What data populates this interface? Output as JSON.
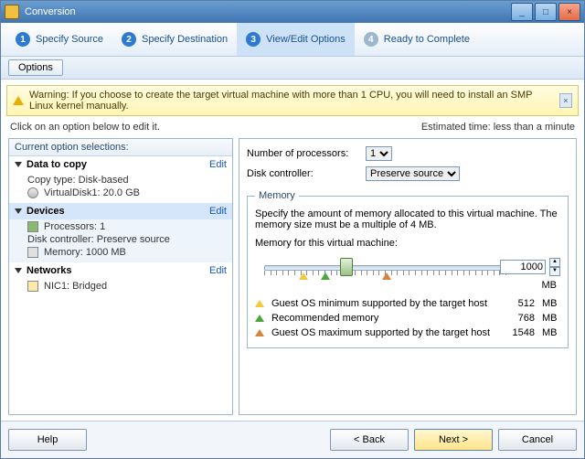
{
  "window": {
    "title": "Conversion"
  },
  "winbtn": {
    "min": "_",
    "max": "□",
    "close": "×"
  },
  "wizard": {
    "steps": [
      {
        "num": "1",
        "label": "Specify Source"
      },
      {
        "num": "2",
        "label": "Specify Destination"
      },
      {
        "num": "3",
        "label": "View/Edit Options"
      },
      {
        "num": "4",
        "label": "Ready to Complete"
      }
    ]
  },
  "optionsButton": "Options",
  "warning": {
    "label": "Warning: If you choose to create the target virtual machine with more than 1 CPU, you will need to install an SMP Linux kernel manually.",
    "close": "×"
  },
  "instruction": "Click on an option below to edit it.",
  "estimate": {
    "label": "Estimated time:",
    "value": "less than a minute"
  },
  "leftTitle": "Current option selections:",
  "editLabel": "Edit",
  "sections": {
    "data": {
      "title": "Data to copy",
      "rows": [
        {
          "label": "Copy type: Disk-based"
        },
        {
          "label": "VirtualDisk1: 20.0 GB"
        }
      ]
    },
    "devices": {
      "title": "Devices",
      "rows": [
        {
          "label": "Processors: 1"
        },
        {
          "label": "Disk controller: Preserve source"
        },
        {
          "label": "Memory: 1000 MB"
        }
      ]
    },
    "networks": {
      "title": "Networks",
      "rows": [
        {
          "label": "NIC1: Bridged"
        }
      ]
    }
  },
  "right": {
    "procLabel": "Number of processors:",
    "procValue": "1",
    "diskLabel": "Disk controller:",
    "diskValue": "Preserve source",
    "memory": {
      "legend": "Memory",
      "help": "Specify the amount of memory allocated to this virtual machine. The memory size must be a multiple of 4 MB.",
      "fieldLabel": "Memory for this virtual machine:",
      "value": "1000",
      "unit": "MB",
      "markers": [
        {
          "type": "y",
          "pos": 13,
          "label": "Guest OS minimum supported by the target host",
          "value": "512",
          "unit": "MB"
        },
        {
          "type": "g",
          "pos": 20,
          "label": "Recommended memory",
          "value": "768",
          "unit": "MB"
        },
        {
          "type": "o",
          "pos": 40,
          "label": "Guest OS maximum supported by the target host",
          "value": "1548",
          "unit": "MB"
        }
      ],
      "thumbPos": 27
    }
  },
  "footer": {
    "help": "Help",
    "back": "< Back",
    "next": "Next >",
    "cancel": "Cancel"
  }
}
